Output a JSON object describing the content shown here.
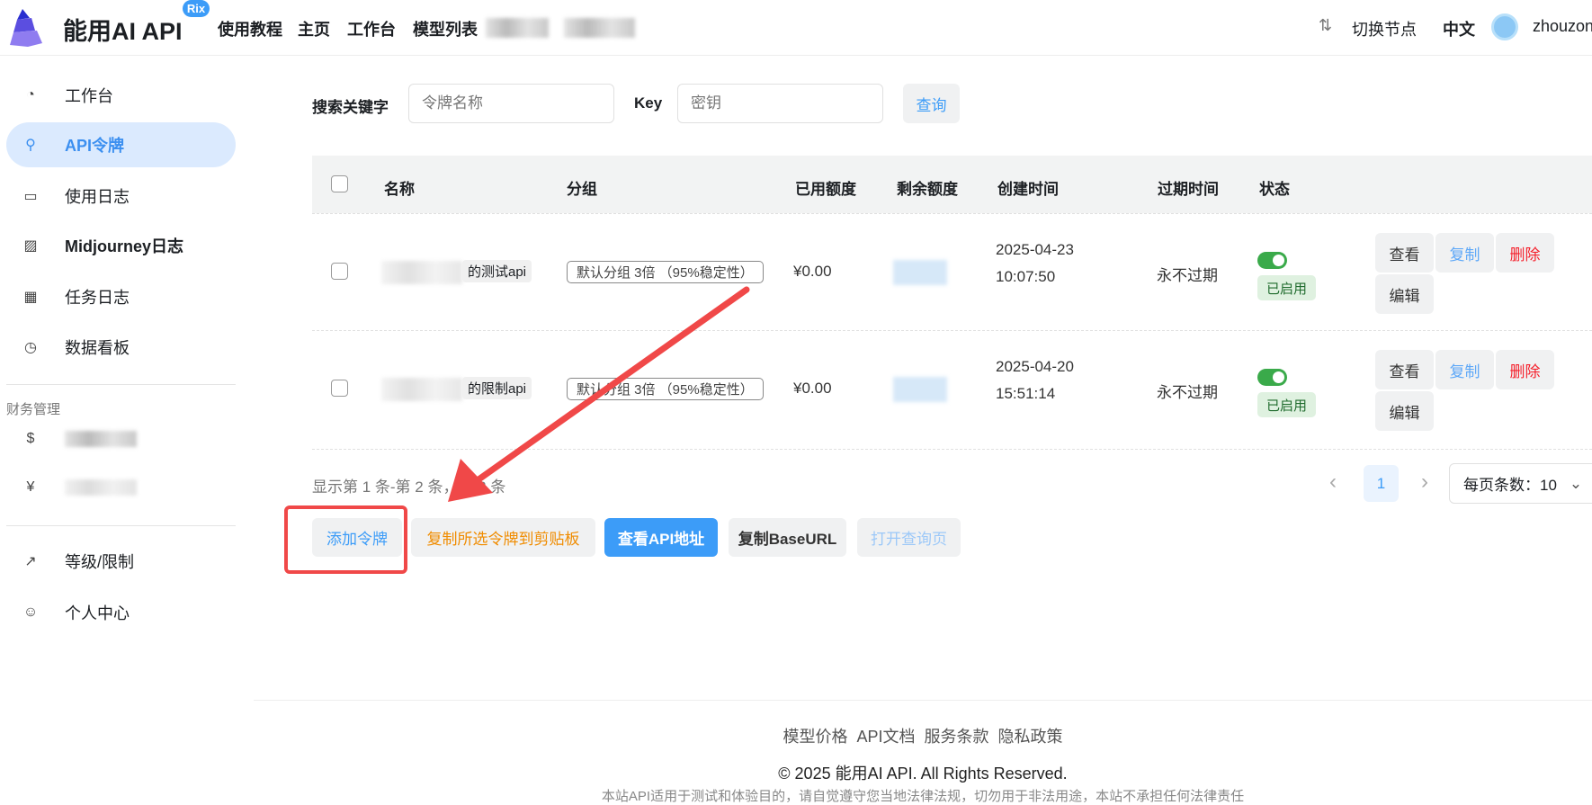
{
  "header": {
    "brand": "能用AI API",
    "badge": "Rix",
    "nav": [
      "使用教程",
      "主页",
      "工作台",
      "模型列表"
    ],
    "switch_node": "切换节点",
    "language": "中文",
    "username": "zhouzon"
  },
  "sidebar": {
    "items": [
      {
        "label": "工作台",
        "icon": "dashboard-icon"
      },
      {
        "label": "API令牌",
        "icon": "key-icon",
        "active": true
      },
      {
        "label": "使用日志",
        "icon": "log-icon"
      },
      {
        "label": "Midjourney日志",
        "icon": "image-icon"
      },
      {
        "label": "任务日志",
        "icon": "film-icon"
      },
      {
        "label": "数据看板",
        "icon": "pie-chart-icon"
      }
    ],
    "finance_title": "财务管理",
    "bottom": [
      {
        "label": "等级/限制",
        "icon": "trend-icon"
      },
      {
        "label": "个人中心",
        "icon": "user-icon"
      }
    ]
  },
  "search": {
    "keyword_label": "搜索关键字",
    "keyword_placeholder": "令牌名称",
    "key_label": "Key",
    "key_placeholder": "密钥",
    "query": "查询"
  },
  "table": {
    "columns": [
      "名称",
      "分组",
      "已用额度",
      "剩余额度",
      "创建时间",
      "过期时间",
      "状态"
    ],
    "rows": [
      {
        "name": "的测试api",
        "group": "默认分组 3倍 （95%稳定性）",
        "used": "¥0.00",
        "created_date": "2025-04-23",
        "created_time": "10:07:50",
        "expire": "永不过期",
        "status": "已启用",
        "enabled": true
      },
      {
        "name": "的限制api",
        "group": "默认分组 3倍 （95%稳定性）",
        "used": "¥0.00",
        "created_date": "2025-04-20",
        "created_time": "15:51:14",
        "expire": "永不过期",
        "status": "已启用",
        "enabled": true
      }
    ],
    "actions": {
      "view": "查看",
      "copy": "复制",
      "delete": "删除",
      "edit": "编辑"
    }
  },
  "pagination": {
    "summary": "显示第 1 条-第 2 条，共 2 条",
    "page": "1",
    "page_size": "每页条数：10"
  },
  "buttons": {
    "add": "添加令牌",
    "copy_selected": "复制所选令牌到剪贴板",
    "view_api": "查看API地址",
    "copy_base": "复制BaseURL",
    "open_query": "打开查询页"
  },
  "footer": {
    "links": [
      "模型价格",
      "API文档",
      "服务条款",
      "隐私政策"
    ],
    "copyright": "© 2025 能用AI API. All Rights Reserved.",
    "disclaimer": "本站API适用于测试和体验目的，请自觉遵守您当地法律法规，切勿用于非法用途，本站不承担任何法律责任"
  },
  "colors": {
    "accent": "#3c9cf8",
    "annotation": "#f04848",
    "success": "#3aaa4a",
    "danger": "#f5222d",
    "warning": "#f08c00"
  }
}
